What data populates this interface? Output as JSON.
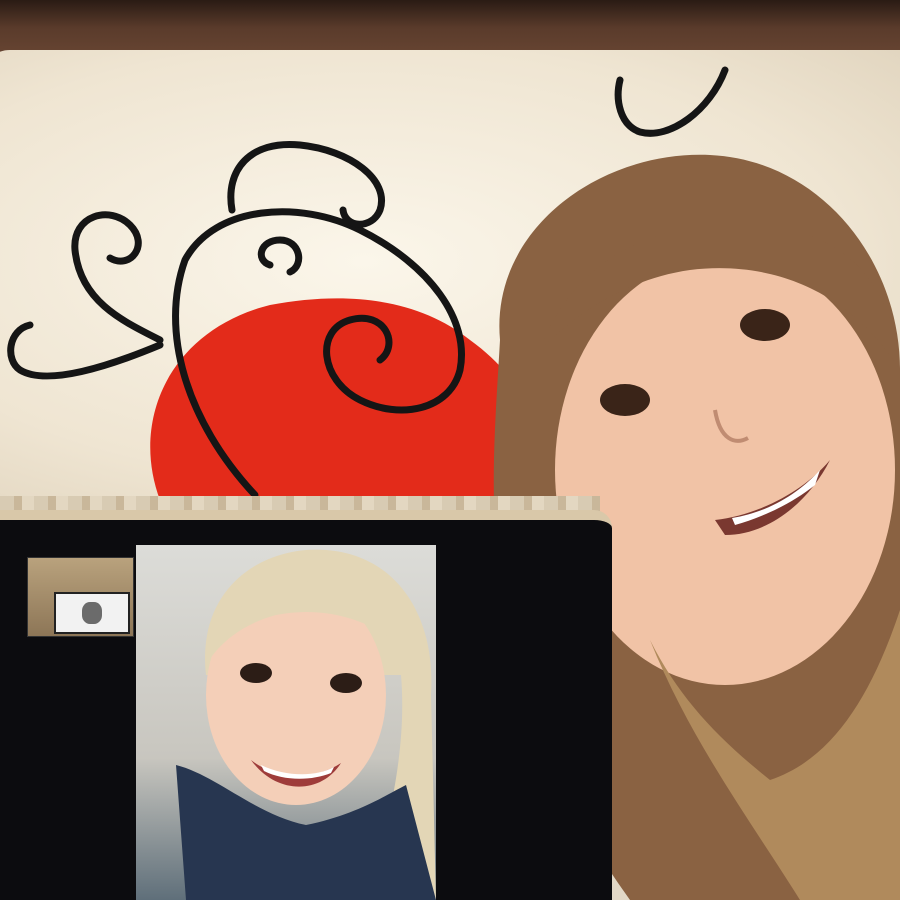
{
  "scene": {
    "description_label": "",
    "colors": {
      "headboard": "#5a3b2b",
      "pillow": "#efe5d2",
      "heart_red": "#e32b1a",
      "swirl": "#161616",
      "laptop_bezel": "#0c0c0f",
      "hair": "#8a6242",
      "skin": "#f1c3a6"
    }
  }
}
